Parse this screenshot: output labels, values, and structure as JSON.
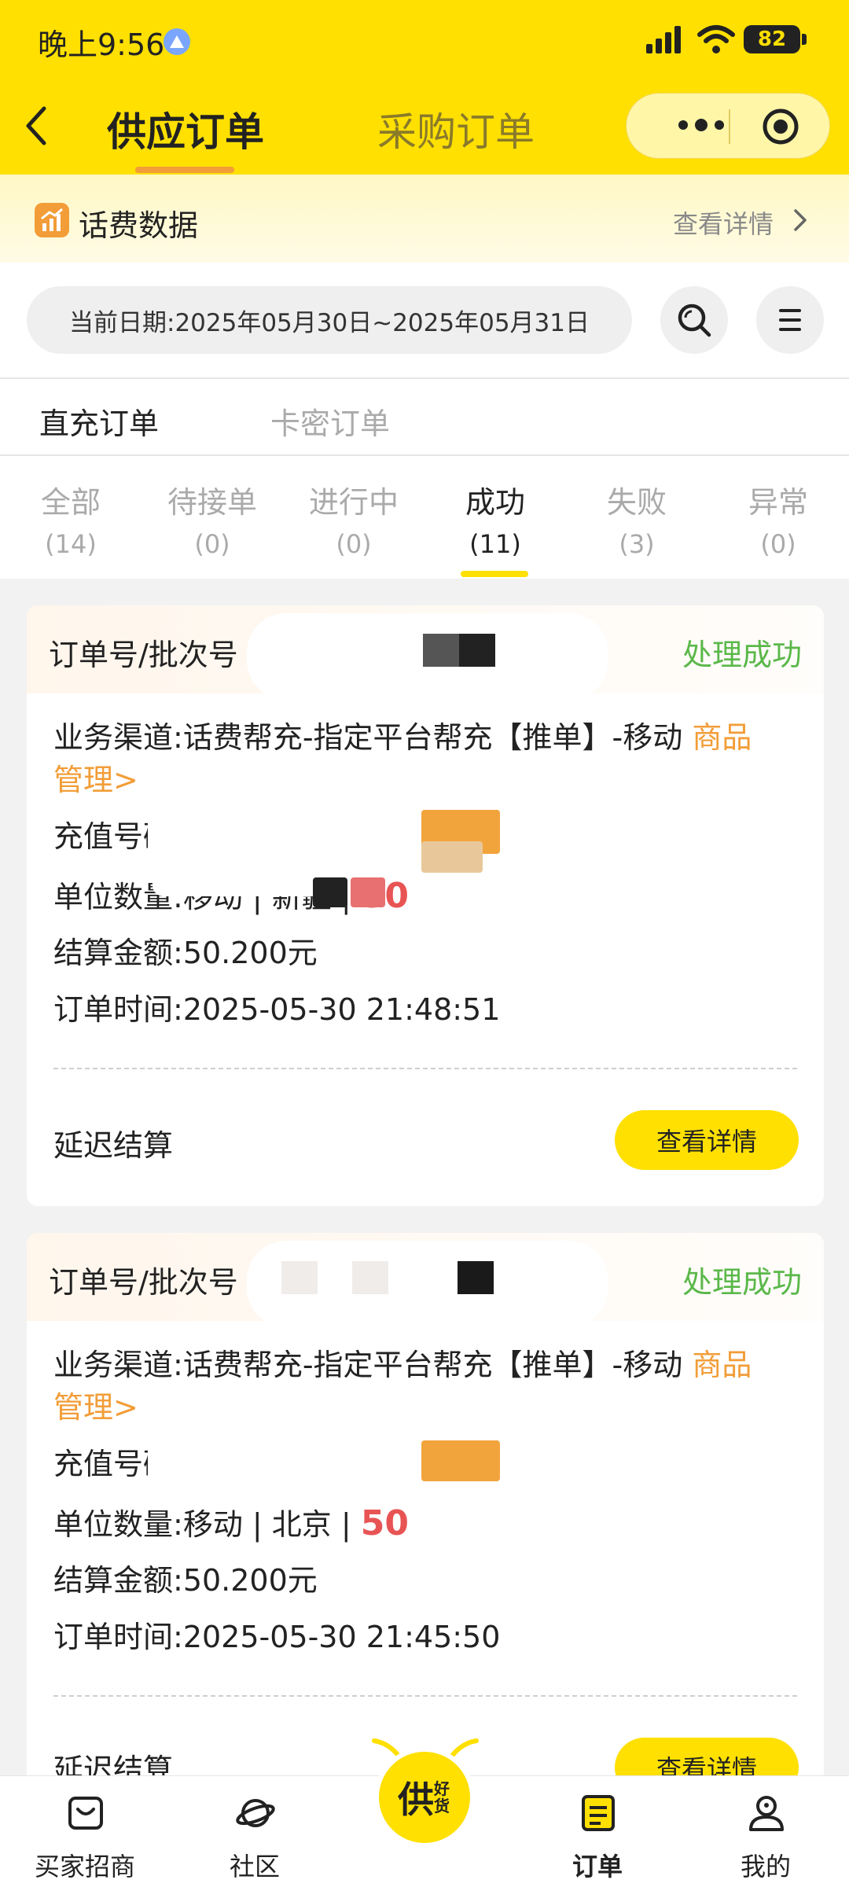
{
  "status_bar": {
    "time": "晚上9:56",
    "battery": "82"
  },
  "header": {
    "tab_active": "供应订单",
    "tab_inactive": "采购订单"
  },
  "fee_bar": {
    "title": "话费数据",
    "detail": "查看详情"
  },
  "search": {
    "date_range": "当前日期:2025年05月30日~2025年05月31日"
  },
  "type_tabs": [
    {
      "label": "直充订单"
    },
    {
      "label": "卡密订单"
    }
  ],
  "status_tabs": [
    {
      "label": "全部",
      "count": "(14)"
    },
    {
      "label": "待接单",
      "count": "(0)"
    },
    {
      "label": "进行中",
      "count": "(0)"
    },
    {
      "label": "成功",
      "count": "(11)"
    },
    {
      "label": "失败",
      "count": "(3)"
    },
    {
      "label": "异常",
      "count": "(0)"
    }
  ],
  "orders": [
    {
      "order_label": "订单号/批次号",
      "status": "处理成功",
      "channel_label": "业务渠道:",
      "channel_value": "话费帮充-指定平台帮充【推单】-移动",
      "manage_link_1": "商品",
      "manage_link_2": "管理>",
      "phone_label": "充值号码",
      "unit_label": "单位数量:",
      "unit_value": "移动 | 新疆 | ",
      "unit_amount": "50",
      "settle_label": "结算金额:",
      "settle_value": "50.200元",
      "time_label": "订单时间:",
      "time_value": "2025-05-30 21:48:51",
      "delay": "延迟结算",
      "detail_button": "查看详情"
    },
    {
      "order_label": "订单号/批次号",
      "status": "处理成功",
      "channel_label": "业务渠道:",
      "channel_value": "话费帮充-指定平台帮充【推单】-移动",
      "manage_link_1": "商品",
      "manage_link_2": "管理>",
      "phone_label": "充值号码",
      "unit_label": "单位数量:",
      "unit_value": "移动 | 北京 | ",
      "unit_amount": "50",
      "settle_label": "结算金额:",
      "settle_value": "50.200元",
      "time_label": "订单时间:",
      "time_value": "2025-05-30 21:45:50",
      "delay": "延迟结算",
      "detail_button": "查看详情"
    }
  ],
  "bottom_nav": [
    {
      "label": "买家招商",
      "icon": "inbox-icon"
    },
    {
      "label": "社区",
      "icon": "planet-icon"
    },
    {
      "label": "订单",
      "icon": "order-list-icon"
    },
    {
      "label": "我的",
      "icon": "user-icon"
    }
  ],
  "center_logo": {
    "big": "供",
    "small": "好货"
  },
  "colors": {
    "brand_yellow": "#ffe000",
    "success_green": "#5bb84a",
    "link_orange": "#f29d38",
    "amount_red": "#e85454"
  }
}
